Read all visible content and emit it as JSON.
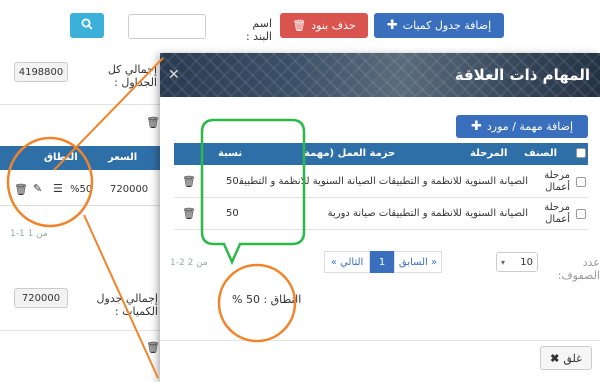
{
  "toolbar": {
    "add_table_label": "إضافة جدول كميات",
    "delete_items_label": "حذف بنود",
    "item_name_label": "اسم البند :"
  },
  "background": {
    "total_all_label": "إجمالي كل الجداول :",
    "total_all_value": "4198800",
    "table_headers": {
      "price": "السعر",
      "scope": "النطاق"
    },
    "row": {
      "price": "720000",
      "scope": "%50"
    },
    "pagination_info": "1-1 من 1",
    "total_table_label": "إجمالي جدول الكميات :",
    "total_table_value": "720000"
  },
  "modal": {
    "title": "المهام ذات العلاقة",
    "add_task_label": "إضافة مهمة / مورد",
    "columns": {
      "category": "الصنف",
      "stage": "المرحلة",
      "package": "حزمة العمل (مهمة",
      "ratio": "نسبة"
    },
    "rows": [
      {
        "category": "مرحلة أعمال",
        "package": "الصيانة السنوية للانظمة و التطبيقات الصيانة السنوية للانظمة و التطبيقات",
        "ratio": "50"
      },
      {
        "category": "مرحلة أعمال",
        "package": "الصيانة السنوية للانظمة و التطبيقات صيانة دورية",
        "ratio": "50"
      }
    ],
    "rows_per_page_label": "عدد الصفوف:",
    "rows_per_page_value": "10",
    "pager": {
      "prev": "« السابق",
      "current": "1",
      "next": "التالي »"
    },
    "range_info": "1-2 من 2",
    "scope_summary": "النطاق : 50 %",
    "close_label": "غلق"
  },
  "colors": {
    "primary": "#3a6fbd",
    "danger": "#d9534f",
    "info": "#3bb0d8",
    "header": "#2f6fa8",
    "annotation_orange": "#f0842a",
    "annotation_green": "#2db84a"
  }
}
